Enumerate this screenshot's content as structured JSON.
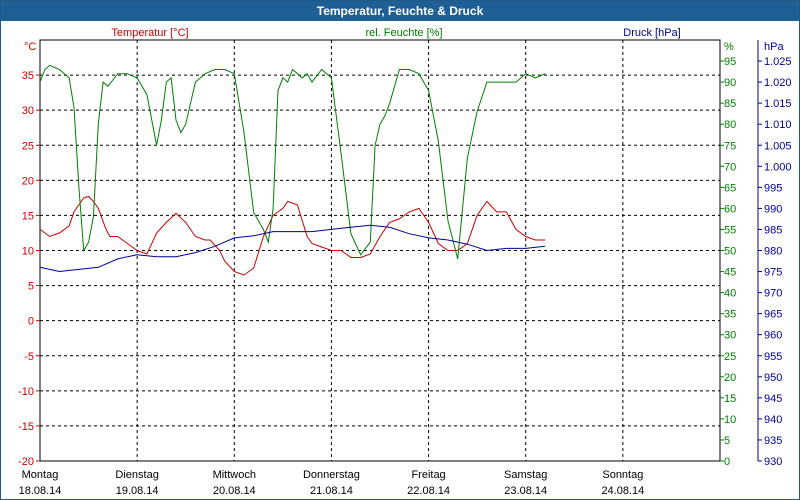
{
  "window": {
    "title": "Temperatur, Feuchte & Druck"
  },
  "colors": {
    "temperature": "#cc0000",
    "humidity": "#008000",
    "pressure": "#000099",
    "grid": "#000000",
    "title_bg": "#1e5f95"
  },
  "chart_data": {
    "type": "line",
    "title": "Temperatur, Feuchte & Druck",
    "grid": true,
    "axes": {
      "temperature": {
        "label": "Temperatur [°C]",
        "unit": "°C",
        "range": [
          -20,
          40
        ],
        "ticks": [
          "40",
          "35",
          "30",
          "25",
          "20",
          "15",
          "10",
          "5",
          "0",
          "-5",
          "-10",
          "-15",
          "-20"
        ]
      },
      "humidity": {
        "label": "rel. Feuchte [%]",
        "unit": "%",
        "range": [
          0,
          100
        ],
        "ticks": [
          "95",
          "90",
          "85",
          "80",
          "75",
          "70",
          "65",
          "60",
          "55",
          "50",
          "45",
          "40",
          "35",
          "30",
          "25",
          "20",
          "15",
          "10",
          "5",
          "0"
        ]
      },
      "pressure": {
        "label": "Druck [hPa]",
        "unit": "hPa",
        "range": [
          930,
          1030
        ],
        "ticks": [
          "1.025",
          "1.020",
          "1.015",
          "1.010",
          "1.005",
          "1.000",
          "995",
          "990",
          "985",
          "980",
          "975",
          "970",
          "965",
          "960",
          "955",
          "950",
          "945",
          "940",
          "935",
          "930"
        ]
      }
    },
    "x_labels": [
      {
        "day": "Montag",
        "date": "18.08.14"
      },
      {
        "day": "Dienstag",
        "date": "19.08.14"
      },
      {
        "day": "Mittwoch",
        "date": "20.08.14"
      },
      {
        "day": "Donnerstag",
        "date": "21.08.14"
      },
      {
        "day": "Freitag",
        "date": "22.08.14"
      },
      {
        "day": "Samstag",
        "date": "23.08.14"
      },
      {
        "day": "Sonntag",
        "date": "24.08.14"
      }
    ],
    "x_range_days": [
      0,
      7
    ],
    "series": [
      {
        "name": "Temperatur [°C]",
        "axis": "temperature",
        "x": [
          0,
          0.1,
          0.2,
          0.3,
          0.35,
          0.45,
          0.5,
          0.55,
          0.6,
          0.68,
          0.72,
          0.8,
          0.9,
          1,
          1.1,
          1.2,
          1.3,
          1.4,
          1.5,
          1.6,
          1.7,
          1.75,
          1.85,
          1.9,
          2,
          2.1,
          2.2,
          2.3,
          2.4,
          2.5,
          2.55,
          2.65,
          2.75,
          2.8,
          2.9,
          3,
          3.1,
          3.2,
          3.3,
          3.4,
          3.5,
          3.6,
          3.7,
          3.8,
          3.9,
          4,
          4.1,
          4.2,
          4.3,
          4.4,
          4.5,
          4.6,
          4.7,
          4.8,
          4.9,
          5,
          5.1,
          5.2
        ],
        "values": [
          13,
          12,
          12.5,
          13.5,
          15.5,
          17.5,
          17.7,
          17,
          16,
          13,
          12,
          12,
          11,
          10,
          9.5,
          12.5,
          14,
          15.3,
          14,
          12,
          11.5,
          11.5,
          10,
          8.5,
          7,
          6.5,
          7.5,
          12,
          15,
          16,
          17,
          16.5,
          12,
          11,
          10.5,
          10,
          10,
          9,
          9,
          9.5,
          12,
          14,
          14.5,
          15.5,
          16,
          14,
          11,
          10,
          10,
          11,
          15,
          17,
          15.5,
          15.5,
          13,
          12,
          11.5,
          11.5
        ]
      },
      {
        "name": "rel. Feuchte [%]",
        "axis": "humidity",
        "x": [
          0,
          0.05,
          0.1,
          0.2,
          0.3,
          0.35,
          0.4,
          0.45,
          0.5,
          0.55,
          0.6,
          0.65,
          0.7,
          0.8,
          0.9,
          1,
          1.1,
          1.2,
          1.25,
          1.3,
          1.35,
          1.4,
          1.45,
          1.5,
          1.6,
          1.7,
          1.8,
          1.9,
          2,
          2.1,
          2.2,
          2.3,
          2.35,
          2.4,
          2.45,
          2.5,
          2.55,
          2.6,
          2.7,
          2.75,
          2.8,
          2.9,
          3,
          3.1,
          3.2,
          3.3,
          3.4,
          3.45,
          3.5,
          3.55,
          3.6,
          3.7,
          3.8,
          3.9,
          4,
          4.1,
          4.2,
          4.3,
          4.4,
          4.5,
          4.6,
          4.7,
          4.8,
          4.9,
          5,
          5.1,
          5.2
        ],
        "values": [
          90,
          93,
          94,
          93,
          91,
          84,
          65,
          50,
          52,
          58,
          80,
          90,
          89,
          92,
          92,
          91,
          87,
          75,
          81,
          90,
          91,
          81,
          78,
          80,
          90,
          92,
          93,
          93,
          92,
          78,
          59,
          55,
          52,
          60,
          88,
          91,
          90,
          93,
          91,
          92,
          90,
          93,
          91,
          73,
          54,
          49,
          52,
          75,
          80,
          82,
          85,
          93,
          93,
          92,
          88,
          76,
          57,
          48,
          72,
          83,
          90,
          90,
          90,
          90,
          92,
          91,
          92
        ]
      },
      {
        "name": "Druck [hPa]",
        "axis": "pressure",
        "x": [
          0,
          0.2,
          0.4,
          0.6,
          0.8,
          1,
          1.2,
          1.4,
          1.6,
          1.8,
          2,
          2.2,
          2.4,
          2.6,
          2.8,
          3,
          3.2,
          3.4,
          3.6,
          3.8,
          4,
          4.2,
          4.4,
          4.6,
          4.8,
          5,
          5.2
        ],
        "values": [
          976,
          975,
          975.5,
          976,
          978,
          979,
          978.5,
          978.5,
          979.5,
          981,
          983,
          983.5,
          984.5,
          984.5,
          984.5,
          985,
          985.5,
          986,
          985.5,
          984,
          983,
          982.5,
          981.5,
          980,
          980.5,
          980.5,
          981
        ]
      }
    ]
  }
}
